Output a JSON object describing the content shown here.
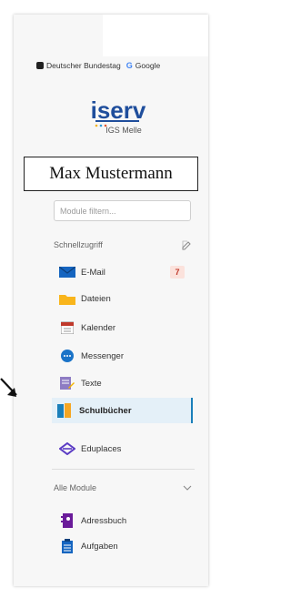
{
  "bookmarks": [
    {
      "label": "Deutscher Bundestag",
      "icon": "bundestag-icon"
    },
    {
      "label": "Google",
      "icon": "google-icon"
    }
  ],
  "brand": {
    "logo_text": "iserv",
    "school": "IGS Melle"
  },
  "user_box": {
    "name": "Max Mustermann"
  },
  "filter": {
    "placeholder": "Module filtern..."
  },
  "quick_access": {
    "title": "Schnellzugriff",
    "items": [
      {
        "label": "E-Mail",
        "icon": "mail-icon",
        "badge": "7"
      },
      {
        "label": "Dateien",
        "icon": "folder-icon"
      },
      {
        "label": "Kalender",
        "icon": "calendar-icon"
      },
      {
        "label": "Messenger",
        "icon": "messenger-icon"
      },
      {
        "label": "Texte",
        "icon": "texts-icon"
      },
      {
        "label": "Schulbücher",
        "icon": "schoolbooks-icon",
        "active": true
      },
      {
        "label": "Eduplaces",
        "icon": "eduplaces-icon"
      }
    ]
  },
  "all_modules": {
    "title": "Alle Module",
    "items": [
      {
        "label": "Adressbuch",
        "icon": "addressbook-icon"
      },
      {
        "label": "Aufgaben",
        "icon": "tasks-icon"
      }
    ]
  },
  "colors": {
    "accent": "#1a7fba",
    "active_bg": "#e4f0f8",
    "badge_bg": "#fbe2dc",
    "badge_text": "#c0392b"
  }
}
